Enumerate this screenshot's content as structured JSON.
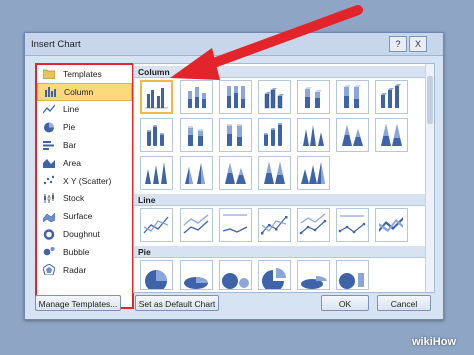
{
  "dialog": {
    "title": "Insert Chart",
    "help_glyph": "?",
    "close_glyph": "X"
  },
  "left_panel": {
    "items": [
      {
        "label": "Templates",
        "icon": "folder-icon",
        "selected": false
      },
      {
        "label": "Column",
        "icon": "column-chart-icon",
        "selected": true
      },
      {
        "label": "Line",
        "icon": "line-chart-icon",
        "selected": false
      },
      {
        "label": "Pie",
        "icon": "pie-chart-icon",
        "selected": false
      },
      {
        "label": "Bar",
        "icon": "bar-chart-icon",
        "selected": false
      },
      {
        "label": "Area",
        "icon": "area-chart-icon",
        "selected": false
      },
      {
        "label": "X Y (Scatter)",
        "icon": "scatter-chart-icon",
        "selected": false
      },
      {
        "label": "Stock",
        "icon": "stock-chart-icon",
        "selected": false
      },
      {
        "label": "Surface",
        "icon": "surface-chart-icon",
        "selected": false
      },
      {
        "label": "Doughnut",
        "icon": "doughnut-chart-icon",
        "selected": false
      },
      {
        "label": "Bubble",
        "icon": "bubble-chart-icon",
        "selected": false
      },
      {
        "label": "Radar",
        "icon": "radar-chart-icon",
        "selected": false
      }
    ]
  },
  "sections": {
    "column": "Column",
    "line": "Line",
    "pie": "Pie"
  },
  "buttons": {
    "manage_templates": "Manage Templates...",
    "set_default": "Set as Default Chart",
    "ok": "OK",
    "cancel": "Cancel"
  },
  "watermark": "wikiHow",
  "colors": {
    "highlight_red": "#e3242b",
    "selection_yellow": "#fbd97c",
    "chart_blue": "#3f63a8"
  }
}
